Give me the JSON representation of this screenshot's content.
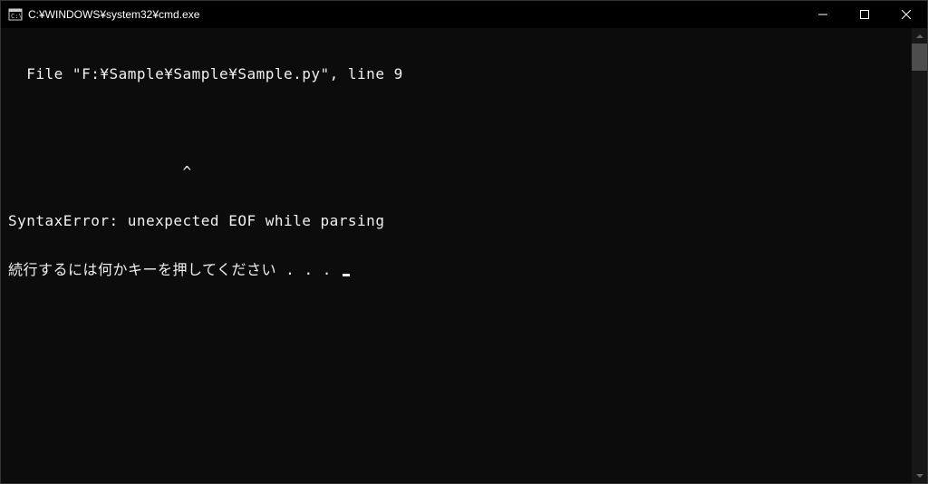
{
  "titlebar": {
    "title": "C:¥WINDOWS¥system32¥cmd.exe"
  },
  "terminal": {
    "lines": [
      "  File \"F:¥Sample¥Sample¥Sample.py\", line 9",
      "",
      "                   ^",
      "SyntaxError: unexpected EOF while parsing",
      "続行するには何かキーを押してください . . . "
    ]
  }
}
